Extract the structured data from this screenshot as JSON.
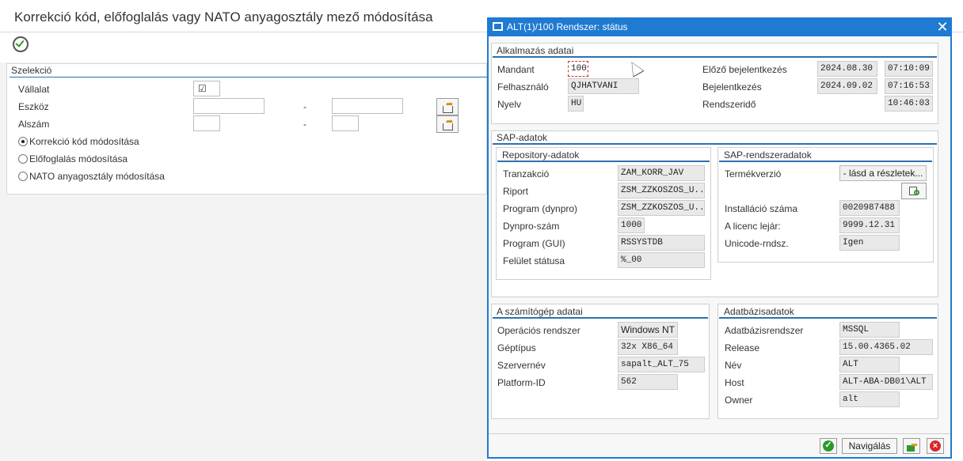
{
  "background": {
    "title": "Korrekció kód, előfoglalás vagy NATO anyagosztály mező módosítása",
    "selection": {
      "group_title": "Szelekció",
      "vallalat_label": "Vállalat",
      "eszkoz_label": "Eszköz",
      "alszam_label": "Alszám",
      "range_dash": "-",
      "radios": [
        {
          "label": "Korrekció kód módosítása",
          "selected": true
        },
        {
          "label": "Előfoglalás módosítása",
          "selected": false
        },
        {
          "label": "NATO anyagosztály módosítása",
          "selected": false
        }
      ]
    }
  },
  "dialog": {
    "title": "ALT(1)/100 Rendszer: státus",
    "close_glyph": "✕",
    "app_data": {
      "title": "Alkalmazás adatai",
      "mandant_label": "Mandant",
      "mandant": "100",
      "user_label": "Felhasználó",
      "user": "QJHATVANI",
      "lang_label": "Nyelv",
      "lang": "HU",
      "prev_login_label": "Előző bejelentkezés",
      "prev_login_date": "2024.08.30",
      "prev_login_time": "07:10:09",
      "login_label": "Bejelentkezés",
      "login_date": "2024.09.02",
      "login_time": "07:16:53",
      "systime_label": "Rendszeridő",
      "systime": "10:46:03"
    },
    "sap": {
      "title": "SAP-adatok",
      "repo": {
        "title": "Repository-adatok",
        "rows": [
          {
            "label": "Tranzakció",
            "value": "ZAM_KORR_JAV"
          },
          {
            "label": "Riport",
            "value": "ZSM_ZZKOSZOS_U..."
          },
          {
            "label": "Program (dynpro)",
            "value": "ZSM_ZZKOSZOS_U..."
          },
          {
            "label": "Dynpro-szám",
            "value": "1000"
          },
          {
            "label": "Program (GUI)",
            "value": "RSSYSTDB"
          },
          {
            "label": "Felület státusa",
            "value": "%_00"
          }
        ]
      },
      "sys": {
        "title": "SAP-rendszeradatok",
        "release_label": "Termékverzió",
        "release_btn": "- lásd a részletek...",
        "install_label": "Installáció száma",
        "install": "0020987488",
        "licence_label": "A licenc lejár:",
        "licence": "9999.12.31",
        "unicode_label": "Unicode-rndsz.",
        "unicode": "Igen"
      }
    },
    "host": {
      "title": "A számítógép adatai",
      "os_label": "Operációs rendszer",
      "os": "Windows NT",
      "machine_label": "Géptípus",
      "machine": "32x X86_64",
      "server_label": "Szervernév",
      "server": "sapalt_ALT_75",
      "platform_label": "Platform-ID",
      "platform": "562"
    },
    "db": {
      "title": "Adatbázisadatok",
      "system_label": "Adatbázisrendszer",
      "system": "MSSQL",
      "release_label": "Release",
      "release": "15.00.4365.02",
      "name_label": "Név",
      "name": "ALT",
      "host_label": "Host",
      "host": "ALT-ABA-DB01\\ALT",
      "owner_label": "Owner",
      "owner": "alt"
    },
    "footer": {
      "nav_label": "Navigálás"
    }
  },
  "colors": {
    "accent": "#1f7ad1",
    "ok": "#2b9a2b",
    "cancel": "#d9262c"
  }
}
